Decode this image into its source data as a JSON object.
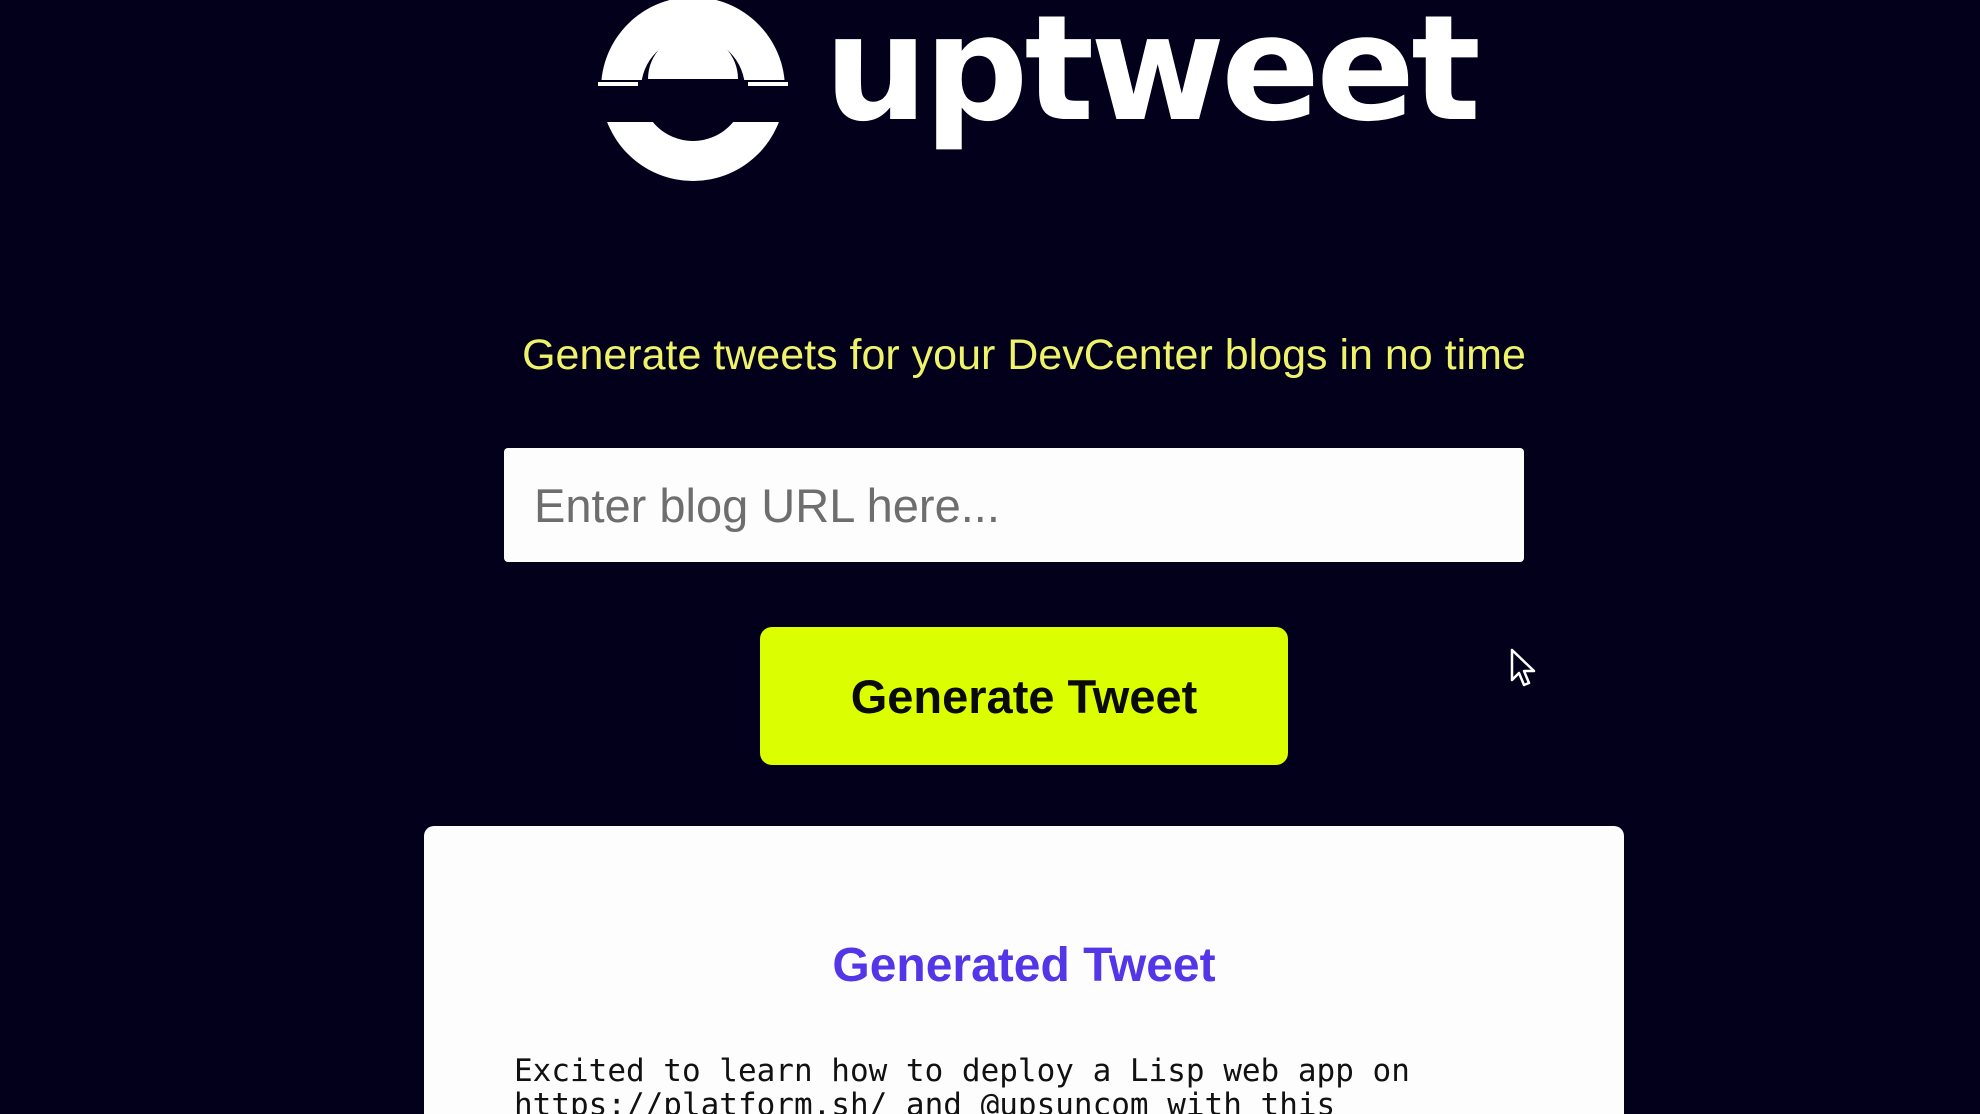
{
  "brand": {
    "name": "uptweet",
    "colors": {
      "background": "#02001a",
      "accent": "#dcff00",
      "tagline": "#eef36a",
      "card_title": "#5236e8",
      "logo": "#ffffff"
    }
  },
  "hero": {
    "tagline": "Generate tweets for your DevCenter blogs in no time"
  },
  "form": {
    "url_placeholder": "Enter blog URL here...",
    "url_value": "",
    "submit_label": "Generate Tweet"
  },
  "result": {
    "title": "Generated Tweet",
    "text": "Excited to learn how to deploy a Lisp web app on https://platform.sh/ and @upsuncom with this"
  },
  "icons": {
    "logo": "uptweet-logo-icon",
    "cursor": "mouse-pointer-icon"
  }
}
